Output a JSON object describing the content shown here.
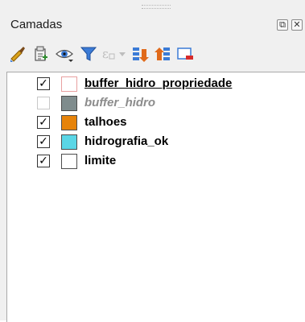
{
  "panel": {
    "title": "Camadas",
    "float_glyph": "⧉",
    "close_glyph": "✕"
  },
  "toolbar": {
    "items": [
      {
        "icon": "style-brush-icon"
      },
      {
        "icon": "add-group-icon"
      },
      {
        "icon": "manage-visibility-icon"
      },
      {
        "icon": "filter-legend-icon"
      },
      {
        "icon": "filter-expression-icon"
      },
      {
        "icon": "expand-all-icon"
      },
      {
        "icon": "collapse-all-icon"
      },
      {
        "icon": "remove-layer-icon"
      }
    ]
  },
  "layers": [
    {
      "name": "buffer_hidro_propriedade",
      "checked": true,
      "check_glyph": "✓",
      "color": "#ffffff",
      "border": "#e8a0a0",
      "selected": true
    },
    {
      "name": "buffer_hidro",
      "checked": false,
      "check_glyph": "",
      "color": "#7f8c8d",
      "border": "#4d4d4d",
      "selected": false
    },
    {
      "name": "talhoes",
      "checked": true,
      "check_glyph": "✓",
      "color": "#e6830a",
      "border": "#4d4d4d",
      "selected": false
    },
    {
      "name": "hidrografia_ok",
      "checked": true,
      "check_glyph": "✓",
      "color": "#5ad6e6",
      "border": "#4d4d4d",
      "selected": false
    },
    {
      "name": "limite",
      "checked": true,
      "check_glyph": "✓",
      "color": "#ffffff",
      "border": "#4d4d4d",
      "selected": false
    }
  ]
}
